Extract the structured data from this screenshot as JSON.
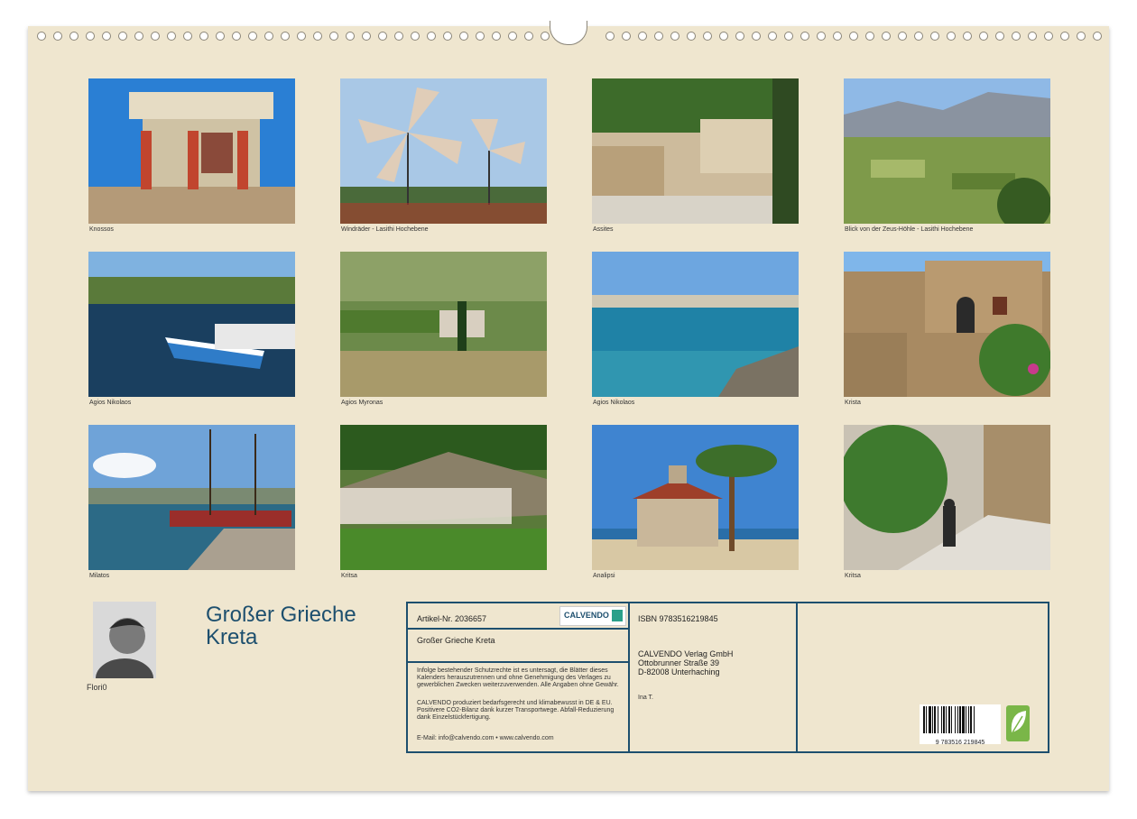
{
  "photos": [
    {
      "caption": "Knossos"
    },
    {
      "caption": "Windräder - Lasithi Hochebene"
    },
    {
      "caption": "Assites"
    },
    {
      "caption": "Blick von der Zeus-Höhle - Lasithi Hochebene"
    },
    {
      "caption": "Agios Nikolaos"
    },
    {
      "caption": "Agios Myronas"
    },
    {
      "caption": "Agios Nikolaos"
    },
    {
      "caption": "Krista"
    },
    {
      "caption": "Milatos"
    },
    {
      "caption": "Kritsa"
    },
    {
      "caption": "Analipsi"
    },
    {
      "caption": "Kritsa"
    }
  ],
  "title": {
    "line1": "Großer Grieche",
    "line2": "Kreta"
  },
  "author": {
    "name": "Flori0"
  },
  "info": {
    "article": "Artikel-Nr. 2036657",
    "product": "Großer Grieche Kreta",
    "legal1": "Infolge bestehender Schutzrechte ist es untersagt, die Blätter dieses Kalenders herauszutrennen und ohne Genehmigung des Verlages zu gewerblichen Zwecken weiterzuverwenden. Alle Angaben ohne Gewähr.",
    "legal2": "CALVENDO produziert bedarfsgerecht und klimabewusst in DE & EU. Positivere CO2-Bilanz dank kurzer Transportwege. Abfall-Reduzierung dank Einzelstückfertigung.",
    "email": "E-Mail: info@calvendo.com • www.calvendo.com",
    "isbn": "ISBN 9783516219845",
    "publisher1": "CALVENDO Verlag GmbH",
    "publisher2": "Ottobrunner Straße 39",
    "publisher3": "D-82008 Unterhaching",
    "author_credit": "Ina T.",
    "logo": "CALVENDO",
    "barcode_number": "9 783516 219845"
  }
}
